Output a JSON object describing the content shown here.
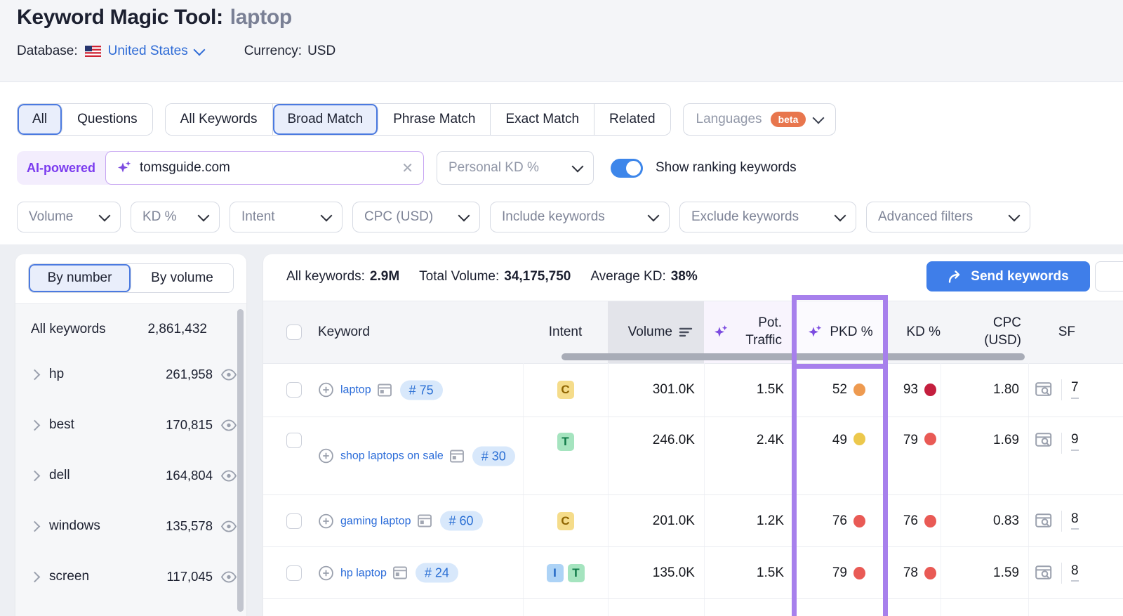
{
  "header": {
    "title": "Keyword Magic Tool:",
    "query": "laptop",
    "database_label": "Database:",
    "database_value": "United States",
    "currency_label": "Currency:",
    "currency_value": "USD"
  },
  "match_tabs": {
    "scope": [
      {
        "label": "All",
        "selected": true
      },
      {
        "label": "Questions",
        "selected": false
      }
    ],
    "match": [
      {
        "label": "All Keywords",
        "selected": false
      },
      {
        "label": "Broad Match",
        "selected": true
      },
      {
        "label": "Phrase Match",
        "selected": false
      },
      {
        "label": "Exact Match",
        "selected": false
      },
      {
        "label": "Related",
        "selected": false
      }
    ],
    "languages_label": "Languages",
    "languages_badge": "beta"
  },
  "search": {
    "ai_label": "AI-powered",
    "query": "tomsguide.com",
    "personal_kd_label": "Personal KD %",
    "toggle_label": "Show ranking keywords",
    "toggle_on": true
  },
  "filters": {
    "volume": "Volume",
    "kd": "KD %",
    "intent": "Intent",
    "cpc": "CPC (USD)",
    "include": "Include keywords",
    "exclude": "Exclude keywords",
    "advanced": "Advanced filters"
  },
  "sidebar": {
    "tabs": [
      {
        "label": "By number",
        "selected": true
      },
      {
        "label": "By volume",
        "selected": false
      }
    ],
    "all_keywords": {
      "label": "All keywords",
      "count": "2,861,432"
    },
    "groups": [
      {
        "name": "hp",
        "count": "261,958"
      },
      {
        "name": "best",
        "count": "170,815"
      },
      {
        "name": "dell",
        "count": "164,804"
      },
      {
        "name": "windows",
        "count": "135,578"
      },
      {
        "name": "screen",
        "count": "117,045"
      }
    ]
  },
  "summary": {
    "all_keywords_label": "All keywords:",
    "all_keywords_value": "2.9M",
    "total_volume_label": "Total Volume:",
    "total_volume_value": "34,175,750",
    "average_kd_label": "Average KD:",
    "average_kd_value": "38%",
    "send_button_label": "Send keywords"
  },
  "table": {
    "headers": {
      "keyword": "Keyword",
      "intent": "Intent",
      "volume": "Volume",
      "pot_traffic_line1": "Pot.",
      "pot_traffic_line2": "Traffic",
      "pkd": "PKD %",
      "kd": "KD %",
      "cpc_line1": "CPC",
      "cpc_line2": "(USD)",
      "sf": "SF"
    },
    "rows": [
      {
        "keyword": "laptop",
        "rank": "# 75",
        "intents": [
          "C"
        ],
        "volume": "301.0K",
        "pot_traffic": "1.5K",
        "pkd": "52",
        "pkd_level": "orange",
        "kd": "93",
        "kd_level": "darkred",
        "cpc": "1.80",
        "sf": "7"
      },
      {
        "keyword": "shop laptops on sale",
        "rank": "# 30",
        "intents": [
          "T"
        ],
        "volume": "246.0K",
        "pot_traffic": "2.4K",
        "pkd": "49",
        "pkd_level": "yellow",
        "kd": "79",
        "kd_level": "red",
        "cpc": "1.69",
        "sf": "9"
      },
      {
        "keyword": "gaming laptop",
        "rank": "# 60",
        "intents": [
          "C"
        ],
        "volume": "201.0K",
        "pot_traffic": "1.2K",
        "pkd": "76",
        "pkd_level": "red",
        "kd": "76",
        "kd_level": "red",
        "cpc": "0.83",
        "sf": "8"
      },
      {
        "keyword": "hp laptop",
        "rank": "# 24",
        "intents": [
          "I",
          "T"
        ],
        "volume": "135.0K",
        "pot_traffic": "1.5K",
        "pkd": "79",
        "pkd_level": "red",
        "kd": "78",
        "kd_level": "red",
        "cpc": "1.59",
        "sf": "8"
      }
    ]
  },
  "icons": {
    "us_flag": "US flag",
    "sparkle": "✦ AI sparkle",
    "clear_x": "✕",
    "chevron_down": "⌄",
    "chevron_right": "›",
    "eye": "view toggle",
    "plus_circle": "⊕ add to list",
    "serp_page": "SERP snapshot",
    "sort_desc": "sorted descending",
    "serp_preview": "SERP features preview",
    "send_arrow": "↱"
  },
  "colors": {
    "accent_blue": "#3f7ee9",
    "link_blue": "#2b6cd9",
    "purple_ai": "#7c4be0",
    "highlight_purple": "#a780ec",
    "beta_orange": "#e8764d",
    "dot_orange": "#ee9a50",
    "dot_yellow": "#ecc84c",
    "dot_red": "#e95a55",
    "dot_darkred": "#c41f3e",
    "intent_c_bg": "#f5dc8a",
    "intent_t_bg": "#a5e4bf",
    "intent_i_bg": "#add3f6"
  }
}
